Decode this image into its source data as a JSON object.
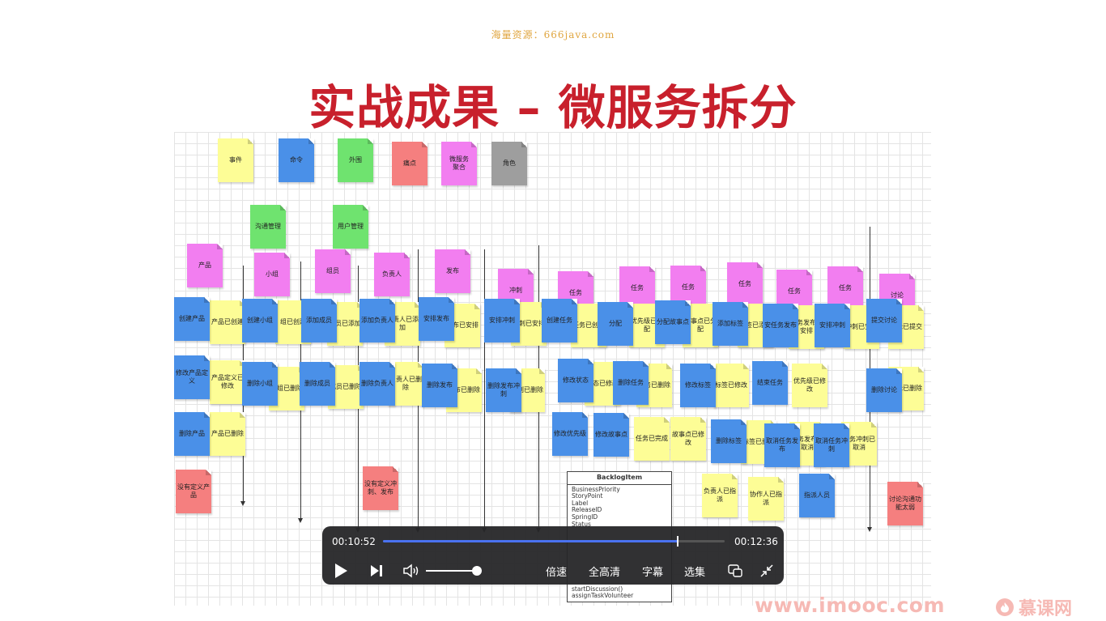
{
  "watermark": "海量资源：666java.com",
  "slide_title": "实战成果 – 微服务拆分",
  "legend": {
    "event": "事件",
    "command": "命令",
    "external": "外围",
    "pain": "痛点",
    "aggregate": "微服务\n聚合",
    "role": "角色"
  },
  "contexts": {
    "communication": "沟通管理",
    "user": "用户管理"
  },
  "aggregates": {
    "product": "产品",
    "group": "小组",
    "member": "组员",
    "owner": "负责人",
    "release": "发布",
    "sprint": "冲刺",
    "task1": "任务",
    "task2": "任务",
    "task3": "任务",
    "task4": "任务",
    "task5": "任务",
    "task6": "任务",
    "discussion": "讨论"
  },
  "commands": {
    "create_product": "创建产品",
    "modify_product": "修改产品定义",
    "delete_product": "删除产品",
    "create_group": "创建小组",
    "delete_group": "删除小组",
    "add_member": "添加成员",
    "delete_member": "删除成员",
    "add_owner": "添加负责人",
    "delete_owner": "删除负责人",
    "schedule_release": "安排发布",
    "delete_release": "删除发布",
    "schedule_sprint": "安排冲刺",
    "delete_release_sprint": "删除发布冲刺",
    "create_task": "创建任务",
    "modify_status": "修改状态",
    "modify_priority": "修改优先级",
    "assign": "分配",
    "delete_task": "删除任务",
    "modify_story": "修改故事点",
    "assign_story": "分配故事点",
    "modify_tag": "修改标签",
    "add_tag": "添加标签",
    "end_task": "结束任务",
    "delete_tag": "删除标签",
    "schedule_task_release": "安任务发布",
    "cancel_task_release": "取消任务发布",
    "schedule_sprint2": "安排冲刺",
    "cancel_task_sprint": "取消任务冲刺",
    "designate": "指派人员",
    "submit_discussion": "提交讨论",
    "delete_discussion": "删除讨论"
  },
  "events": {
    "product_created": "产品已创建",
    "product_modified": "产品定义已修改",
    "product_deleted": "产品已删除",
    "group_created": "组已创建",
    "group_deleted": "小组已删除",
    "member_added": "成员已添加",
    "member_deleted": "成员已删除",
    "owner_added": "负责人已添加",
    "owner_deleted": "负责人已删除",
    "release_scheduled": "发布已安排",
    "release_deleted": "发布已删除",
    "sprint_scheduled": "冲刺已安排",
    "release_sprint_deleted": "冲刺已删除",
    "task_created": "任务已创建",
    "status_modified": "状态已修改",
    "task_assigned": "优先级已分配",
    "task_deleted": "任务已删除",
    "priority_modified": "任务已完成",
    "story_assigned": "故事点已分配",
    "story_modified": "故事点已修改",
    "tag_added": "标签已添加",
    "tag_modified": "标签已修改",
    "priority_changed": "优先级已修改",
    "tag_deleted": "标签已删除",
    "task_release_scheduled": "任务发布已安排",
    "task_release_cancelled": "任务发布已取消",
    "sprint_scheduled2": "冲刺已安排",
    "task_sprint_cancelled": "任务冲刺已取消",
    "owner_designated": "负责人已指派",
    "collaborator_designated": "协作人已指派",
    "discussion_submitted": "讨论已提交",
    "discussion_deleted": "讨论已删除"
  },
  "pains": {
    "undefined_product": "没有定义产品",
    "undefined_sprint": "没有定义冲刺、发布",
    "discussion_too_simple": "讨论沟通功能太弱"
  },
  "uml": {
    "title": "BacklogItem",
    "fields": [
      "BusinessPriority",
      "StoryPoint",
      "Label",
      "ReleaseID",
      "SpringID",
      "Status"
    ],
    "methods": [
      "startDiscussion()",
      "assignTaskVolunteer"
    ]
  },
  "player": {
    "current_time": "00:10:52",
    "total_time": "00:12:36",
    "progress": 0.8624,
    "volume": 0.95,
    "speed_label": "倍速",
    "quality_label": "全高清",
    "subtitle_label": "字幕",
    "episodes_label": "选集",
    "icons": [
      "play-icon",
      "next-icon",
      "volume-icon",
      "pip-icon",
      "exit-fullscreen-icon"
    ]
  },
  "brand": {
    "url": "www.imooc.com",
    "name": "慕课网"
  },
  "colors": {
    "title": "#c8202c",
    "event": "#fdfd96",
    "command": "#4a90e8",
    "external": "#6fe36f",
    "pain": "#f57f7f",
    "aggregate": "#f27ef0",
    "role": "#9e9e9e",
    "progress": "#4a72f0"
  }
}
